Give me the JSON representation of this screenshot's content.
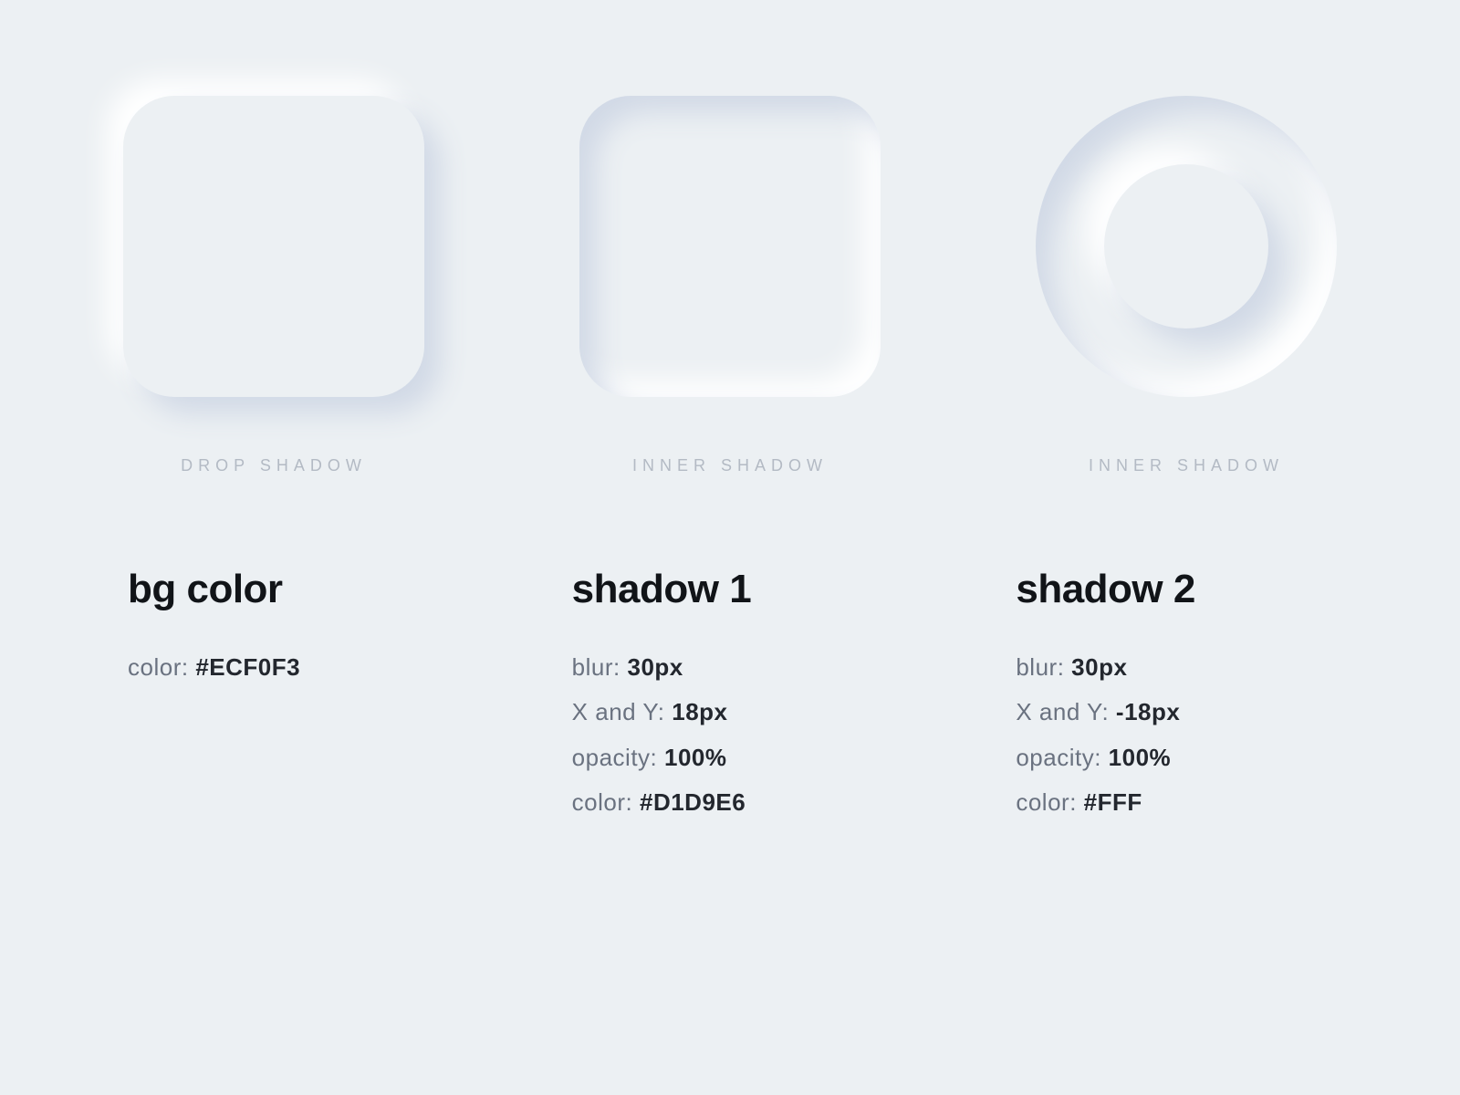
{
  "bg_color": "#ECF0F3",
  "captions": {
    "drop": "DROP SHADOW",
    "inner1": "INNER SHADOW",
    "inner2": "INNER SHADOW"
  },
  "spec_bg": {
    "title": "bg color",
    "color_label": "color: ",
    "color_value": "#ECF0F3"
  },
  "spec_s1": {
    "title": "shadow 1",
    "blur_label": "blur: ",
    "blur_value": "30px",
    "xy_label": "X and Y: ",
    "xy_value": "18px",
    "opacity_label": "opacity: ",
    "opacity_value": "100%",
    "color_label": "color: ",
    "color_value": "#D1D9E6"
  },
  "spec_s2": {
    "title": "shadow 2",
    "blur_label": "blur: ",
    "blur_value": "30px",
    "xy_label": "X and Y: ",
    "xy_value": "-18px",
    "opacity_label": "opacity: ",
    "opacity_value": "100%",
    "color_label": "color: ",
    "color_value": "#FFF"
  }
}
